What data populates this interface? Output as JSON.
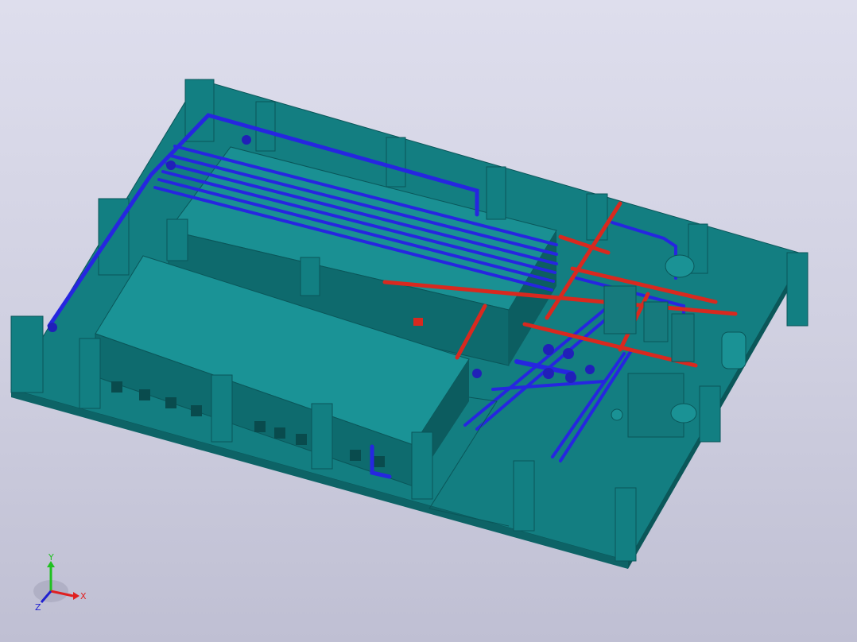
{
  "viewport": {
    "background_top": "#dedeed",
    "background_bottom": "#bfbfd3"
  },
  "model": {
    "colors": {
      "structure": "#127f82",
      "structure_dark": "#0b5b5e",
      "structure_light": "#1c9a9d",
      "cold_pipe": "#2626e0",
      "hot_pipe": "#d8291f"
    }
  },
  "axis": {
    "x_label": "X",
    "y_label": "Y",
    "z_label": "Z",
    "x_color": "#e02020",
    "y_color": "#20c020",
    "z_color": "#2020d0"
  }
}
